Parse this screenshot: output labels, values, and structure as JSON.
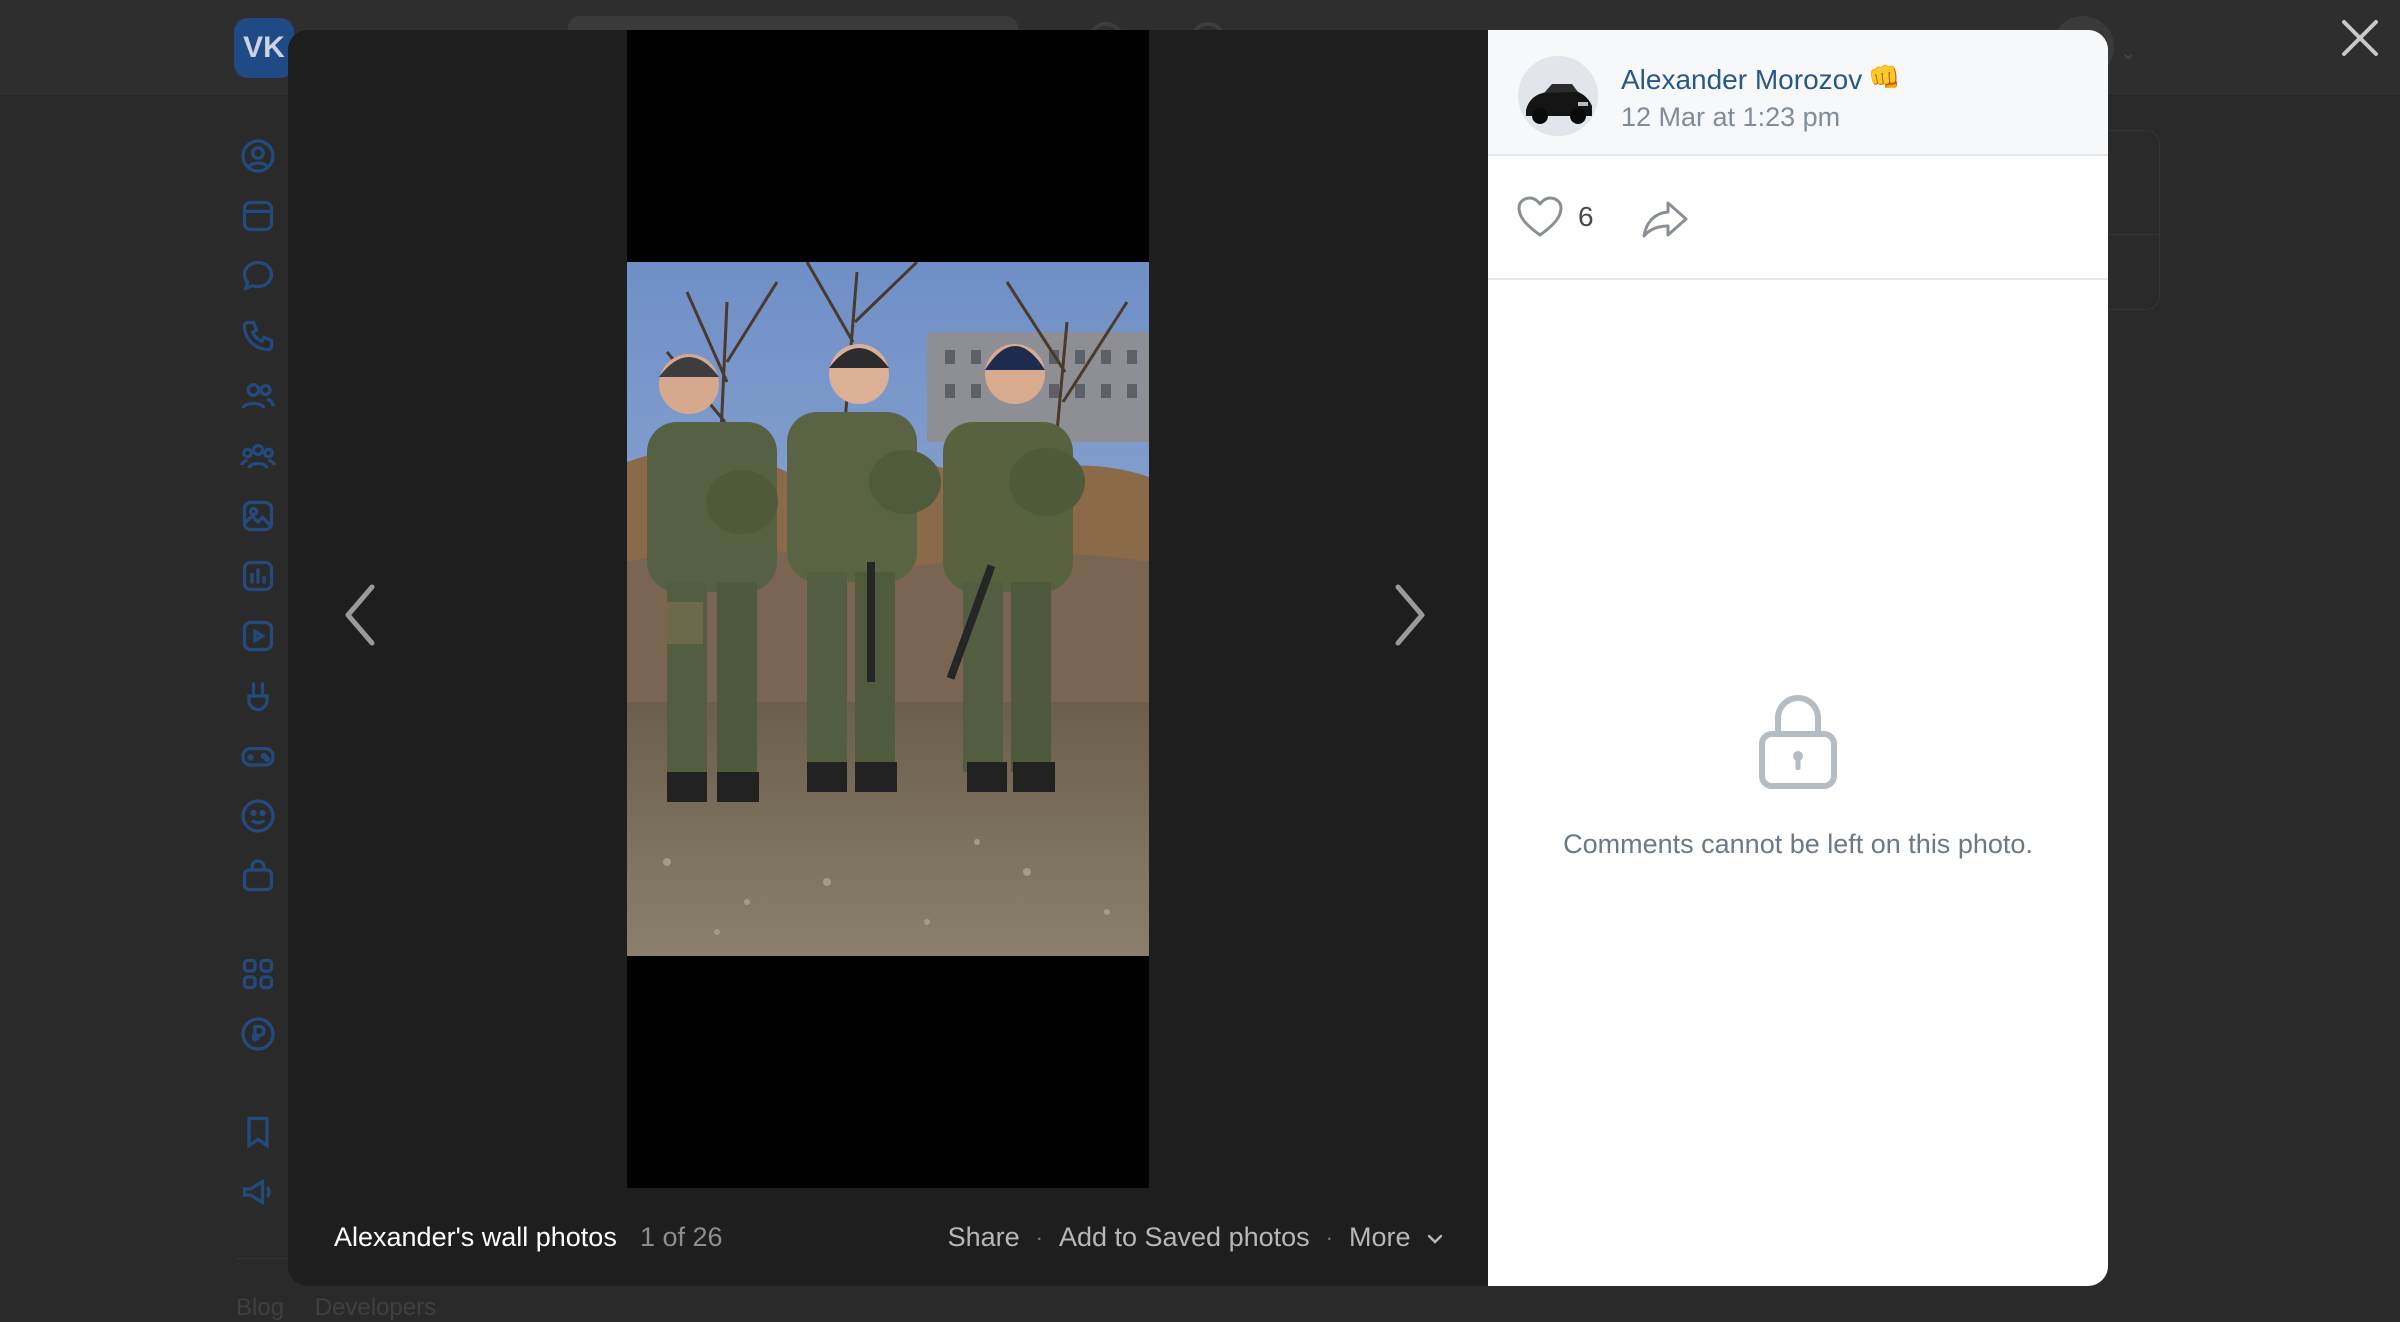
{
  "background": {
    "logo_text": "VK",
    "footer_links": [
      "Blog",
      "Developers"
    ]
  },
  "viewer": {
    "album_title": "Alexander's wall photos",
    "counter": "1 of 26",
    "actions": {
      "share_label": "Share",
      "save_label": "Add to Saved photos",
      "more_label": "More"
    }
  },
  "panel": {
    "author_name": "Alexander Morozov",
    "author_emoji": "👊",
    "date": "12 Mar at 1:23 pm",
    "likes": "6",
    "locked_message": "Comments cannot be left on this photo."
  },
  "icons": {
    "close": "close-icon",
    "prev": "chevron-left-icon",
    "next": "chevron-right-icon",
    "like": "heart-icon",
    "share": "share-arrow-icon",
    "lock": "lock-icon",
    "more": "chevron-down-icon"
  },
  "colors": {
    "link": "#2a5885",
    "muted": "#818c99",
    "overlay": "#2a2a2b",
    "stage": "#1e1e1e"
  }
}
